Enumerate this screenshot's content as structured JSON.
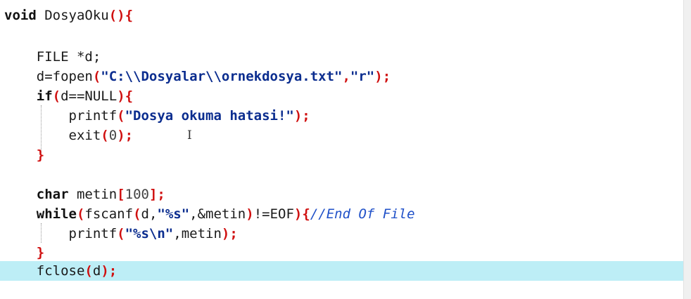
{
  "editor": {
    "language": "C",
    "highlight_color": "#bdeef6",
    "lines": [
      {
        "id": "l1",
        "text": "void DosyaOku(){"
      },
      {
        "id": "l3",
        "text": "    FILE *d;"
      },
      {
        "id": "l4",
        "text": "    d=fopen(\"C:\\\\Dosyalar\\\\ornekdosya.txt\",\"r\");"
      },
      {
        "id": "l5",
        "text": "    if(d==NULL){"
      },
      {
        "id": "l6",
        "text": "        printf(\"Dosya okuma hatasi!\");"
      },
      {
        "id": "l7",
        "text": "        exit(0);"
      },
      {
        "id": "l8",
        "text": "    }"
      },
      {
        "id": "l10",
        "text": "    char metin[100];"
      },
      {
        "id": "l11",
        "text": "    while(fscanf(d,\"%s\",&metin)!=EOF){//End Of File"
      },
      {
        "id": "l12",
        "text": "        printf(\"%s\\n\",metin);"
      },
      {
        "id": "l13",
        "text": "    }"
      },
      {
        "id": "l14",
        "text": "    fclose(d);"
      }
    ]
  },
  "tokens": {
    "l1": [
      "void",
      " DosyaOku",
      "(",
      ")",
      "{"
    ],
    "l3": [
      "FILE",
      " *d;"
    ],
    "l4": [
      "d=fopen",
      "(",
      "\"C:\\\\Dosyalar\\\\ornekdosya.txt\"",
      ",",
      "\"r\"",
      ")",
      ";"
    ],
    "l5": [
      "if",
      "(",
      "d==NULL",
      ")",
      "{"
    ],
    "l6": [
      "printf",
      "(",
      "\"Dosya okuma hatasi!\"",
      ")",
      ";"
    ],
    "l7": [
      "exit",
      "(",
      "0",
      ")",
      ";"
    ],
    "l8": [
      "}"
    ],
    "l10": [
      "char",
      " metin",
      "[",
      "100",
      "]",
      ";"
    ],
    "l11": [
      "while",
      "(",
      "fscanf",
      "(",
      "d,",
      "\"%s\"",
      ",&metin",
      ")",
      "!=EOF",
      ")",
      "{",
      "//End Of File"
    ],
    "l12": [
      "printf",
      "(",
      "\"%s\\n\"",
      ",metin",
      ")",
      ";"
    ],
    "l13": [
      "}"
    ],
    "l14": [
      "fclose",
      "(",
      "d",
      ")",
      ";"
    ]
  },
  "cursor_icon": "text-ibeam-icon"
}
